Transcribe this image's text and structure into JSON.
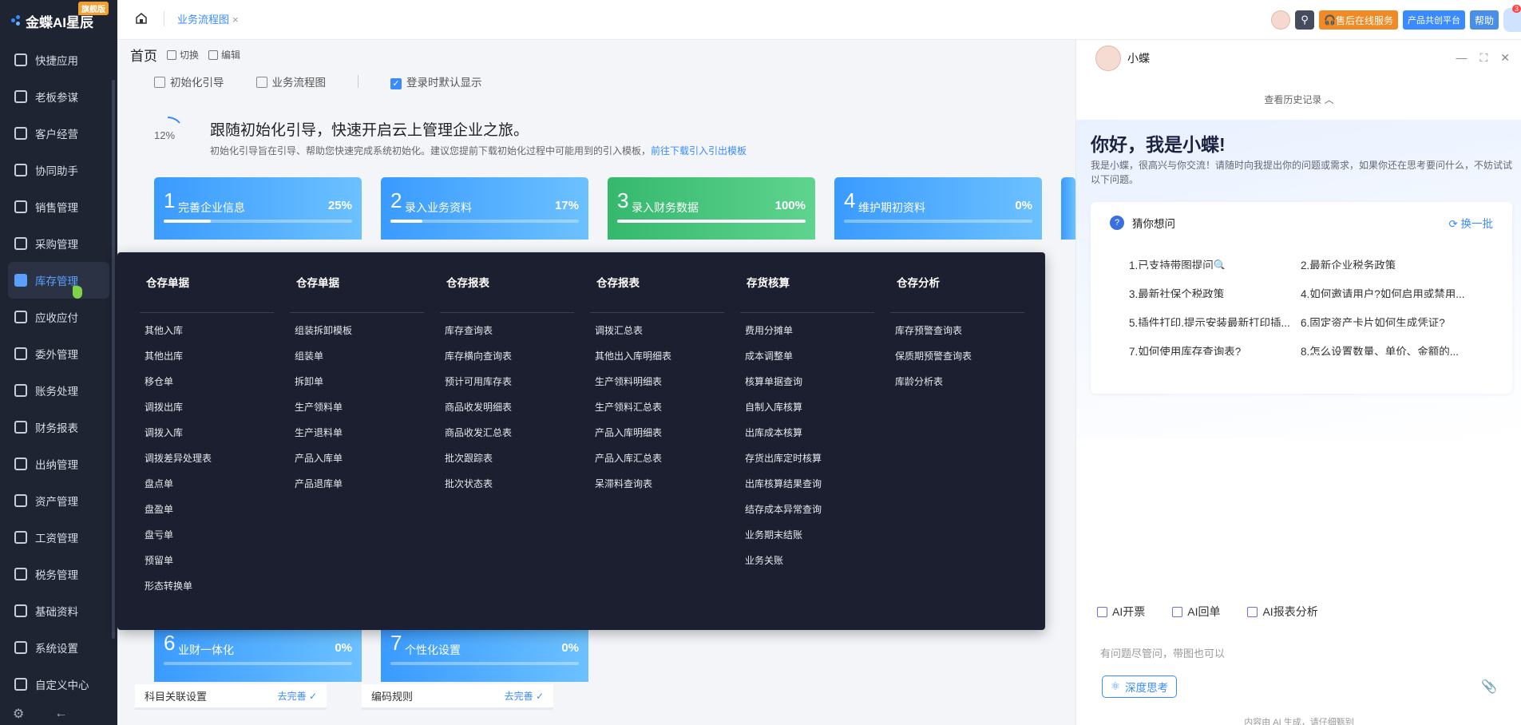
{
  "logo": {
    "text": "金蝶AI星辰",
    "flag": "旗舰版"
  },
  "sidebar": {
    "items": [
      {
        "label": "快捷应用"
      },
      {
        "label": "老板参谋"
      },
      {
        "label": "客户经营"
      },
      {
        "label": "协同助手"
      },
      {
        "label": "销售管理"
      },
      {
        "label": "采购管理"
      },
      {
        "label": "库存管理"
      },
      {
        "label": "应收应付"
      },
      {
        "label": "委外管理"
      },
      {
        "label": "账务处理"
      },
      {
        "label": "财务报表"
      },
      {
        "label": "出纳管理"
      },
      {
        "label": "资产管理"
      },
      {
        "label": "工资管理"
      },
      {
        "label": "税务管理"
      },
      {
        "label": "基础资料"
      },
      {
        "label": "系统设置"
      },
      {
        "label": "自定义中心"
      }
    ],
    "active_index": 6
  },
  "topbar": {
    "tab": "业务流程图",
    "service_label": "售后在线服务",
    "platform_label": "产品共创平台",
    "help_label": "帮助",
    "notice_count": "3"
  },
  "page": {
    "title": "首页",
    "switch_label": "切换",
    "edit_label": "编辑",
    "subtab_init": "初始化引导",
    "subtab_flow": "业务流程图",
    "default_show": "登录时默认显示",
    "progress": "12%",
    "headline": "跟随初始化引导，快速开启云上管理企业之旅。",
    "desc": "初始化引导旨在引导、帮助您快速完成系统初始化。建议您提前下载初始化过程中可能用到的引入模板，",
    "desc_link": "前往下载引入引出模板"
  },
  "cards": [
    {
      "num": "1",
      "name": "完善企业信息",
      "pct": "25%",
      "progress": 0.25
    },
    {
      "num": "2",
      "name": "录入业务资料",
      "pct": "17%",
      "progress": 0.17
    },
    {
      "num": "3",
      "name": "录入财务数据",
      "pct": "100%",
      "progress": 1.0
    },
    {
      "num": "4",
      "name": "维护期初资料",
      "pct": "0%",
      "progress": 0
    },
    {
      "num": "6",
      "name": "业财一体化",
      "pct": "0%",
      "progress": 0
    },
    {
      "num": "7",
      "name": "个性化设置",
      "pct": "0%",
      "progress": 0
    }
  ],
  "subrows": [
    {
      "label": "科目关联设置",
      "go": "去完善"
    },
    {
      "label": "编码规则",
      "go": "去完善"
    }
  ],
  "mega_menu": [
    {
      "title": "仓存单据",
      "items": [
        "其他入库",
        "其他出库",
        "移仓单",
        "调拨出库",
        "调拨入库",
        "调拨差异处理表",
        "盘点单",
        "盘盈单",
        "盘亏单",
        "预留单",
        "形态转换单"
      ]
    },
    {
      "title": "仓存单据",
      "items": [
        "组装拆卸模板",
        "组装单",
        "拆卸单",
        "生产领料单",
        "生产退料单",
        "产品入库单",
        "产品退库单"
      ]
    },
    {
      "title": "仓存报表",
      "items": [
        "库存查询表",
        "库存横向查询表",
        "预计可用库存表",
        "商品收发明细表",
        "商品收发汇总表",
        "批次跟踪表",
        "批次状态表"
      ]
    },
    {
      "title": "仓存报表",
      "items": [
        "调拨汇总表",
        "其他出入库明细表",
        "生产领料明细表",
        "生产领料汇总表",
        "产品入库明细表",
        "产品入库汇总表",
        "呆滞料查询表"
      ]
    },
    {
      "title": "存货核算",
      "items": [
        "费用分摊单",
        "成本调整单",
        "核算单据查询",
        "自制入库核算",
        "出库成本核算",
        "存货出库定时核算",
        "出库核算结果查询",
        "结存成本异常查询",
        "业务期末结账",
        "业务关账"
      ]
    },
    {
      "title": "仓存分析",
      "items": [
        "库存预警查询表",
        "保质期预警查询表",
        "库龄分析表"
      ]
    }
  ],
  "chat": {
    "name": "小蝶",
    "history": "查看历史记录",
    "greeting": "你好，我是小蝶!",
    "intro": "我是小蝶，很高兴与你交流！请随时向我提出你的问题或需求，如果你还在思考要问什么，不妨试试以下问题。",
    "guess_title": "猜你想问",
    "swap_label": "换一批",
    "questions": [
      "1.已支持带图提问🔍",
      "2.最新企业税务政策",
      "3.最新社保个税政策",
      "4.如何邀请用户?如何启用或禁用...",
      "5.插件打印,提示安装最新打印插...",
      "6.固定资产卡片如何生成凭证?",
      "7.如何使用库存查询表?",
      "8.怎么设置数量、单价、金额的..."
    ],
    "quick_actions": [
      "AI开票",
      "AI回单",
      "AI报表分析"
    ],
    "input_placeholder": "有问题尽管问，带图也可以",
    "deep_think": "深度思考",
    "footnote": "内容由 AI 生成，请仔细甄别"
  }
}
